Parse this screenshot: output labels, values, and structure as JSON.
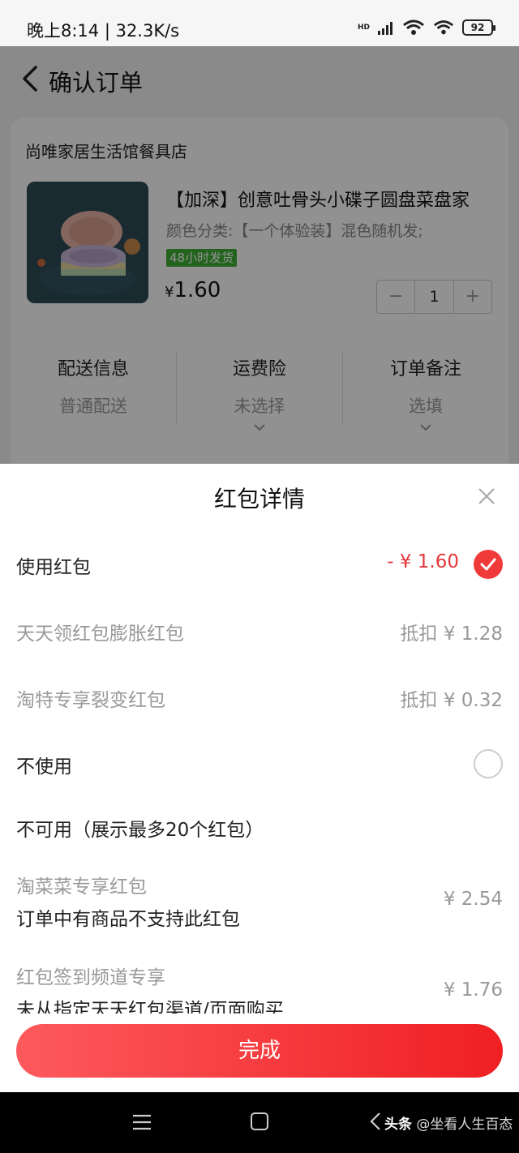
{
  "status_bar": {
    "text": "晚上8:14 | 32.3K/s",
    "hd": "HD",
    "battery": "92"
  },
  "page": {
    "title": "确认订单"
  },
  "order": {
    "shop_name": "尚唯家居生活馆餐具店",
    "product_title": "【加深】创意吐骨头小碟子圆盘菜盘家",
    "product_spec": "颜色分类:【一个体验装】混色随机发;",
    "shipping_badge": "48小时发货",
    "price_symbol": "¥",
    "price": "1.60",
    "quantity": "1",
    "minus": "−",
    "plus": "+",
    "info": [
      {
        "title": "配送信息",
        "value": "普通配送"
      },
      {
        "title": "运费险",
        "value": "未选择"
      },
      {
        "title": "订单备注",
        "value": "选填"
      }
    ]
  },
  "sheet": {
    "title": "红包详情",
    "use_label": "使用红包",
    "use_value": "- ¥ 1.60",
    "redpacks": [
      {
        "label": "天天领红包膨胀红包",
        "value": "抵扣 ¥ 1.28"
      },
      {
        "label": "淘特专享裂变红包",
        "value": "抵扣 ¥ 0.32"
      }
    ],
    "no_use_label": "不使用",
    "unavailable_header": "不可用（展示最多20个红包）",
    "unavailable": [
      {
        "name": "淘菜菜专享红包",
        "reason": "订单中有商品不支持此红包",
        "value": "¥ 2.54"
      },
      {
        "name": "红包签到频道专享",
        "reason": "未从指定天天红包渠道/页面购买",
        "value": "¥ 1.76"
      }
    ],
    "done_label": "完成"
  },
  "watermark": {
    "brand": "头条",
    "text": " @坐看人生百态"
  },
  "colors": {
    "accent_red": "#f03a3a",
    "ship_green": "#3fae36"
  }
}
